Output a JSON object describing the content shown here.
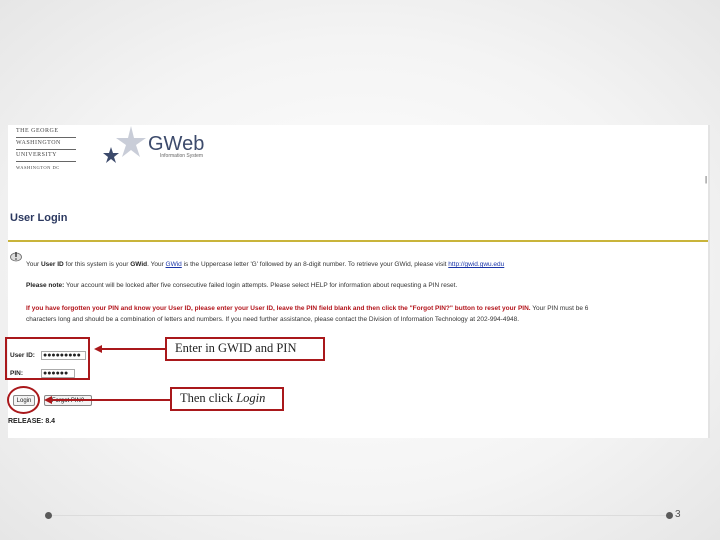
{
  "university_logo": {
    "line1": "THE GEORGE",
    "line2": "WASHINGTON",
    "line3": "UNIVERSITY",
    "line4": "WASHINGTON DC"
  },
  "app": {
    "title": "GWeb",
    "subtitle": "Information System"
  },
  "page_title": "User Login",
  "info": {
    "line1_pre": "Your ",
    "line1_bold": "User ID",
    "line1_mid": " for this system is your ",
    "line1_bold2": "GWid",
    "line1_mid2": ". Your ",
    "line1_link": "GWid",
    "line1_post": " is the Uppercase letter 'G' followed by an 8-digit number. To retrieve your GWid, please visit ",
    "line1_url": "http://gwid.gwu.edu",
    "line2_bold": "Please note:",
    "line2_text": " Your account will be locked after five consecutive failed login attempts. Please select HELP for information about requesting a PIN reset.",
    "line3_red": "If you have forgotten your PIN and know your User ID, please enter your User ID, leave the PIN field blank and then click the \"Forgot PIN?\" button to reset your PIN.",
    "line3_text": " Your PIN must be 6",
    "line4_text": "characters long and should be a combination of letters and numbers. If you need further assistance, please contact the Division of Information Technology at 202-994-4948."
  },
  "form": {
    "userid_label": "User ID:",
    "userid_value": "●●●●●●●●●",
    "pin_label": "PIN:",
    "pin_value": "●●●●●●",
    "login_button": "Login",
    "forgot_button": "Forgot PIN?"
  },
  "release": "RELEASE: 8.4",
  "callouts": {
    "enter": "Enter in GWID and PIN",
    "click_pre": "Then click ",
    "click_em": "Login"
  },
  "slide_number": "3",
  "colors": {
    "accent": "#a9181b",
    "rule": "#c9b43a",
    "title": "#2c3960"
  }
}
